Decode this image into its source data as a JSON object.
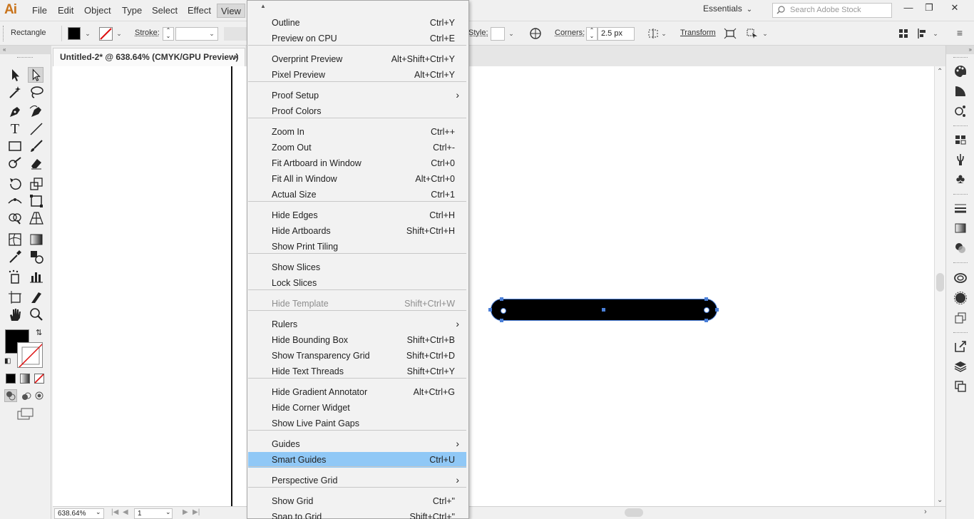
{
  "app": {
    "logo": "Ai",
    "menu": [
      "File",
      "Edit",
      "Object",
      "Type",
      "Select",
      "Effect",
      "View"
    ],
    "active_menu": "View",
    "workspace": "Essentials",
    "search_placeholder": "Search Adobe Stock",
    "window_controls": [
      "minimize",
      "restore",
      "close"
    ],
    "window_glyphs": [
      "—",
      "❐",
      "✕"
    ]
  },
  "controlbar": {
    "tool_name": "Rectangle",
    "stroke_label": "Stroke:",
    "style_label": "Style:",
    "corners_label": "Corners:",
    "corners_value": "2.5 px",
    "transform_label": "Transform",
    "fill_color": "#000000"
  },
  "document": {
    "tab_title": "Untitled-2* @ 638.64% (CMYK/GPU Preview)",
    "close_glyph": "×",
    "zoom": "638.64%",
    "page": "1"
  },
  "view_menu": {
    "items": [
      {
        "label": "Outline",
        "shortcut": "Ctrl+Y"
      },
      {
        "label": "Preview on CPU",
        "shortcut": "Ctrl+E"
      },
      {
        "label": "Overprint Preview",
        "shortcut": "Alt+Shift+Ctrl+Y"
      },
      {
        "label": "Pixel Preview",
        "shortcut": "Alt+Ctrl+Y"
      },
      {
        "label": "Proof Setup",
        "shortcut": ""
      },
      {
        "label": "Proof Colors",
        "shortcut": ""
      },
      {
        "label": "Zoom In",
        "shortcut": "Ctrl++"
      },
      {
        "label": "Zoom Out",
        "shortcut": "Ctrl+-"
      },
      {
        "label": "Fit Artboard in Window",
        "shortcut": "Ctrl+0"
      },
      {
        "label": "Fit All in Window",
        "shortcut": "Alt+Ctrl+0"
      },
      {
        "label": "Actual Size",
        "shortcut": "Ctrl+1"
      },
      {
        "label": "Hide Edges",
        "shortcut": "Ctrl+H"
      },
      {
        "label": "Hide Artboards",
        "shortcut": "Shift+Ctrl+H"
      },
      {
        "label": "Show Print Tiling",
        "shortcut": ""
      },
      {
        "label": "Show Slices",
        "shortcut": ""
      },
      {
        "label": "Lock Slices",
        "shortcut": ""
      },
      {
        "label": "Hide Template",
        "shortcut": "Shift+Ctrl+W"
      },
      {
        "label": "Rulers",
        "shortcut": ""
      },
      {
        "label": "Hide Bounding Box",
        "shortcut": "Shift+Ctrl+B"
      },
      {
        "label": "Show Transparency Grid",
        "shortcut": "Shift+Ctrl+D"
      },
      {
        "label": "Hide Text Threads",
        "shortcut": "Shift+Ctrl+Y"
      },
      {
        "label": "Hide Gradient Annotator",
        "shortcut": "Alt+Ctrl+G"
      },
      {
        "label": "Hide Corner Widget",
        "shortcut": ""
      },
      {
        "label": "Show Live Paint Gaps",
        "shortcut": ""
      },
      {
        "label": "Guides",
        "shortcut": ""
      },
      {
        "label": "Smart Guides",
        "shortcut": "Ctrl+U"
      },
      {
        "label": "Perspective Grid",
        "shortcut": ""
      },
      {
        "label": "Show Grid",
        "shortcut": "Ctrl+\""
      },
      {
        "label": "Snap to Grid",
        "shortcut": "Shift+Ctrl+\""
      }
    ],
    "highlighted": "Smart Guides",
    "disabled": [
      "Hide Template"
    ],
    "submenus": [
      "Proof Setup",
      "Rulers",
      "Guides",
      "Perspective Grid"
    ],
    "highlight_color": "#90c8f6"
  },
  "colors": {
    "selection": "#4a7fd8",
    "logo": "#c9741c"
  },
  "icons": {
    "tools": [
      "selection-tool-icon",
      "direct-selection-tool-icon",
      "magic-wand-tool-icon",
      "lasso-tool-icon",
      "pen-tool-icon",
      "curvature-tool-icon",
      "type-tool-icon",
      "line-segment-tool-icon",
      "rectangle-tool-icon",
      "paintbrush-tool-icon",
      "shaper-tool-icon",
      "eraser-tool-icon",
      "rotate-tool-icon",
      "scale-tool-icon",
      "width-tool-icon",
      "free-transform-tool-icon",
      "shape-builder-tool-icon",
      "perspective-grid-tool-icon",
      "mesh-tool-icon",
      "gradient-tool-icon",
      "eyedropper-tool-icon",
      "blend-tool-icon",
      "symbol-sprayer-tool-icon",
      "column-graph-tool-icon",
      "artboard-tool-icon",
      "slice-tool-icon",
      "hand-tool-icon",
      "zoom-tool-icon"
    ]
  }
}
